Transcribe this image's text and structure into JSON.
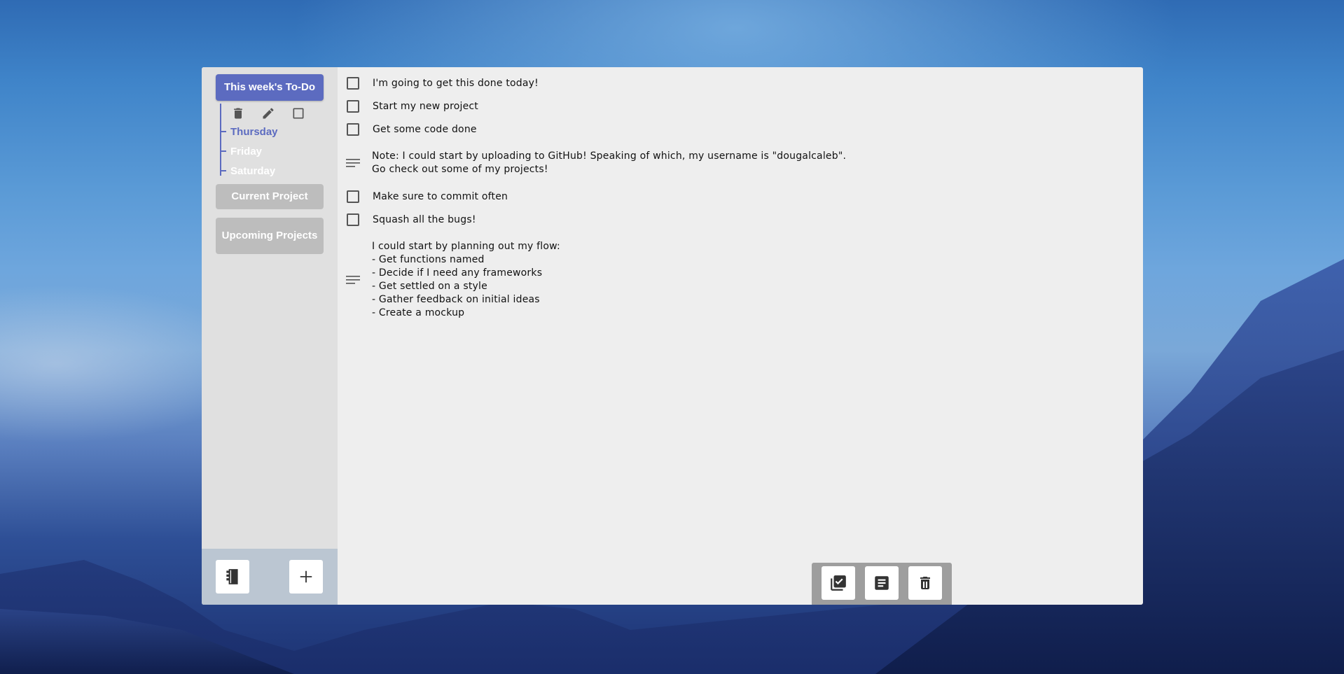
{
  "sidebar": {
    "active_list": "This week's To-Do",
    "days": [
      "Thursday",
      "Friday",
      "Saturday"
    ],
    "lists": [
      "Current Project",
      "Upcoming Projects"
    ]
  },
  "items": [
    {
      "type": "task",
      "text": "I'm going to get this done today!",
      "checked": false
    },
    {
      "type": "task",
      "text": "Start my new project",
      "checked": false
    },
    {
      "type": "task",
      "text": "Get some code done",
      "checked": false
    },
    {
      "type": "note",
      "text": "Note: I could start by uploading to GitHub! Speaking of which, my username is \"dougalcaleb\".\nGo check out some of my projects!"
    },
    {
      "type": "task",
      "text": "Make sure to commit often",
      "checked": false
    },
    {
      "type": "task",
      "text": "Squash all the bugs!",
      "checked": false
    },
    {
      "type": "note",
      "text": "I could start by planning out my flow:\n- Get functions named\n- Decide if I need any frameworks\n- Get settled on a style\n- Gather feedback on initial ideas\n- Create a mockup"
    }
  ],
  "colors": {
    "accent": "#5c6bc0",
    "inactive": "#bdbdbd",
    "panel": "#eeeeee",
    "sidebar": "#e0e0e0",
    "bar": "#9e9e9e"
  },
  "icons": {
    "sidebar_tools": [
      "trash-icon",
      "pencil-icon",
      "square-icon"
    ],
    "sidebar_footer": [
      "notebook-icon",
      "plus-icon"
    ],
    "bottom_bar": [
      "checklist-icon",
      "note-icon",
      "trash-icon"
    ]
  }
}
